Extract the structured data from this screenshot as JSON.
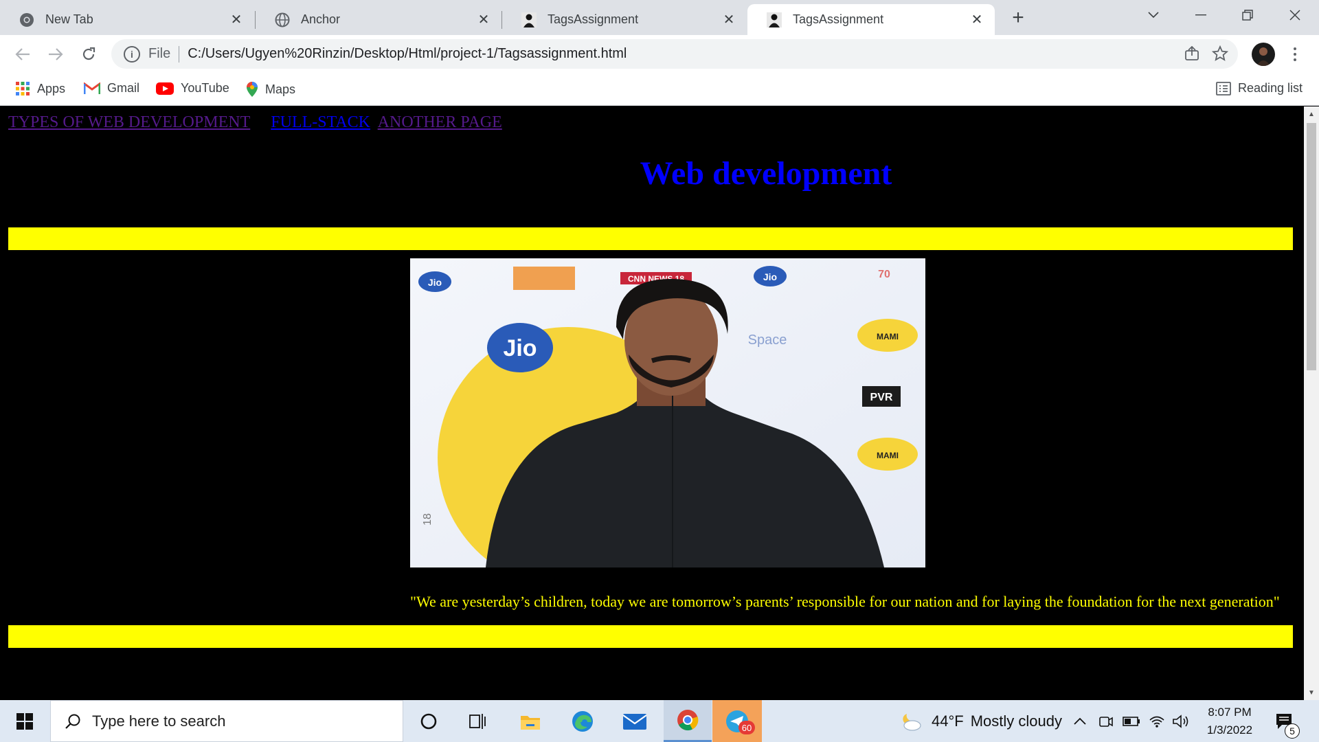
{
  "browser": {
    "tabs": [
      {
        "title": "New Tab",
        "icon": "chrome-icon",
        "active": false
      },
      {
        "title": "Anchor",
        "icon": "globe-icon",
        "active": false
      },
      {
        "title": "TagsAssignment",
        "icon": "page-favicon",
        "active": false
      },
      {
        "title": "TagsAssignment",
        "icon": "page-favicon",
        "active": true
      }
    ],
    "new_tab_glyph": "+",
    "close_glyph": "✕",
    "address": {
      "scheme": "File",
      "url": "C:/Users/Ugyen%20Rinzin/Desktop/Html/project-1/Tagsassignment.html"
    },
    "bookmarks": [
      {
        "label": "Apps",
        "icon": "apps-grid-icon"
      },
      {
        "label": "Gmail",
        "icon": "gmail-icon"
      },
      {
        "label": "YouTube",
        "icon": "youtube-icon"
      },
      {
        "label": "Maps",
        "icon": "maps-icon"
      }
    ],
    "reading_list": "Reading list"
  },
  "page": {
    "nav_links": [
      "TYPES OF WEB DEVELOPMENT",
      "FULL-STACK",
      "ANOTHER PAGE"
    ],
    "heading": "Web development",
    "quote": "\"We are yesterday’s children, today we are tomorrow’s parents’ responsible for our nation and for laying the foundation for the next generation\"",
    "photo_backdrop_text": {
      "brand1": "Jio",
      "brand2": "Jio",
      "brand3": "Jio",
      "news": "CNN NEWS 18",
      "space": "Space",
      "pvr": "PVR",
      "mami": "MAMI",
      "seventy": "70",
      "eighteen": "18"
    },
    "colors": {
      "background": "#000000",
      "heading": "#0000ff",
      "bar": "#ffff00",
      "quote": "#ffff00",
      "visited_link": "#551a8b",
      "link": "#0000ee"
    }
  },
  "taskbar": {
    "search_placeholder": "Type here to search",
    "weather": {
      "temp": "44°F",
      "condition": "Mostly cloudy"
    },
    "clock": {
      "time": "8:07 PM",
      "date": "1/3/2022"
    },
    "telegram_badge": "60",
    "notification_count": "5"
  }
}
